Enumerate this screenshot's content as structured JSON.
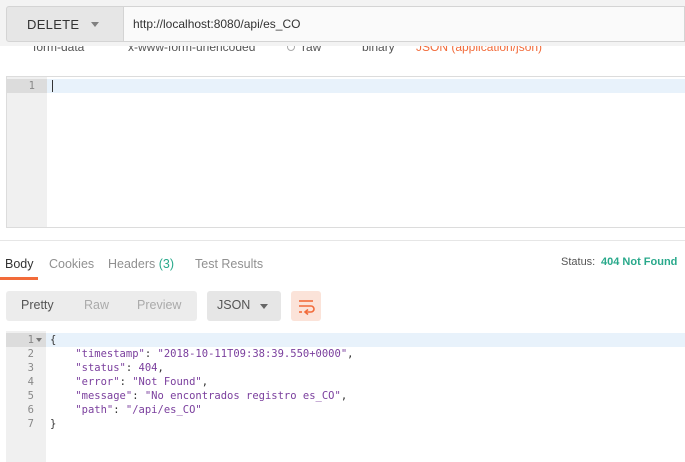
{
  "request": {
    "method": "DELETE",
    "url": "http://localhost:8080/api/es_CO"
  },
  "body_types": {
    "form_data": "form-data",
    "urlencoded": "x-www-form-urlencoded",
    "raw": "raw",
    "binary": "binary",
    "json": "JSON (application/json)"
  },
  "request_editor": {
    "line_numbers": [
      "1"
    ]
  },
  "response_tabs": {
    "body": "Body",
    "cookies": "Cookies",
    "headers": "Headers",
    "headers_count": "(3)",
    "test_results": "Test Results"
  },
  "status": {
    "label": "Status:",
    "value": "404 Not Found"
  },
  "view_modes": {
    "pretty": "Pretty",
    "raw": "Raw",
    "preview": "Preview"
  },
  "format": {
    "selected": "JSON"
  },
  "response": {
    "line_numbers": [
      "1",
      "2",
      "3",
      "4",
      "5",
      "6",
      "7"
    ],
    "lines": {
      "open": "{",
      "timestamp_key": "\"timestamp\"",
      "timestamp_value": "\"2018-10-11T09:38:39.550+0000\"",
      "status_key": "\"status\"",
      "status_value": "404",
      "error_key": "\"error\"",
      "error_value": "\"Not Found\"",
      "message_key": "\"message\"",
      "message_value": "\"No encontrados registro es_CO\"",
      "path_key": "\"path\"",
      "path_value": "\"/api/es_CO\"",
      "close": "}"
    }
  },
  "colors": {
    "accent": "#f26b3a",
    "status_ok": "#29a98b",
    "json_token": "#7a3e9d"
  }
}
